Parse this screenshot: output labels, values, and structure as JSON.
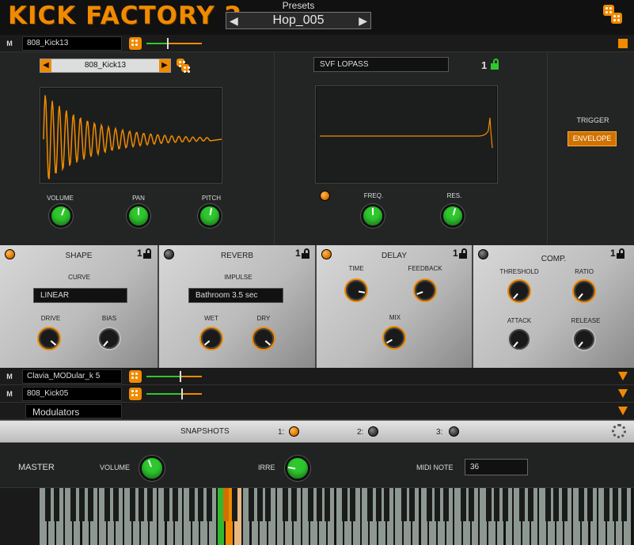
{
  "header": {
    "logo": "KICK FACTORY 2",
    "presets_label": "Presets",
    "preset_name": "Hop_005",
    "prev_glyph": "◀",
    "next_glyph": "▶"
  },
  "tracks": [
    {
      "mute_label": "M",
      "name": "808_Kick13",
      "level": 0.38,
      "indicator": "orange-square"
    },
    {
      "mute_label": "M",
      "name": "Clavia_MODular_k 5",
      "level": 0.62,
      "indicator": "orange-triangle"
    },
    {
      "mute_label": "M",
      "name": "808_Kick05",
      "level": 0.64,
      "indicator": "orange-triangle"
    },
    {
      "mute_label": "",
      "name": "Modulators",
      "indicator": "orange-triangle"
    }
  ],
  "sample": {
    "name": "808_Kick13",
    "knobs": [
      {
        "label": "VOLUME",
        "value": 0.55
      },
      {
        "label": "PAN",
        "value": 0.5
      },
      {
        "label": "PITCH",
        "value": 0.52
      }
    ]
  },
  "filter": {
    "type": "SVF LOPASS",
    "lock_number": "1",
    "knobs": [
      {
        "label": "FREQ.",
        "value": 0.5
      },
      {
        "label": "RES.",
        "value": 0.52
      }
    ]
  },
  "trigger": {
    "label": "TRIGGER",
    "mode": "ENVELOPE"
  },
  "fx": {
    "shape": {
      "title": "SHAPE",
      "enabled": true,
      "lock_number": "1",
      "curve_label": "CURVE",
      "curve": "LINEAR",
      "knobs": [
        {
          "label": "DRIVE"
        },
        {
          "label": "BIAS"
        }
      ]
    },
    "reverb": {
      "title": "REVERB",
      "enabled": false,
      "lock_number": "1",
      "impulse_label": "IMPULSE",
      "impulse": "Bathroom 3.5 sec",
      "knobs": [
        {
          "label": "WET"
        },
        {
          "label": "DRY"
        }
      ]
    },
    "delay": {
      "title": "DELAY",
      "enabled": true,
      "lock_number": "1",
      "knobs": [
        {
          "label": "TIME"
        },
        {
          "label": "FEEDBACK"
        },
        {
          "label": "MIX"
        }
      ]
    },
    "comp": {
      "title": "COMP.",
      "enabled": false,
      "lock_number": "1",
      "knobs": [
        {
          "label": "THRESHOLD"
        },
        {
          "label": "RATIO"
        },
        {
          "label": "ATTACK"
        },
        {
          "label": "RELEASE"
        }
      ]
    }
  },
  "snapshots": {
    "label": "SNAPSHOTS",
    "slots": [
      {
        "label": "1:",
        "active": true
      },
      {
        "label": "2:",
        "active": false
      },
      {
        "label": "3:",
        "active": false
      }
    ]
  },
  "master": {
    "label": "MASTER",
    "volume_label": "VOLUME",
    "irre_label": "IRRE",
    "midi_note_label": "MIDI NOTE",
    "midi_note": "36"
  },
  "colors": {
    "accent": "#f08a00",
    "knob_green": "#2ec82e",
    "background": "#1a1a1a"
  }
}
